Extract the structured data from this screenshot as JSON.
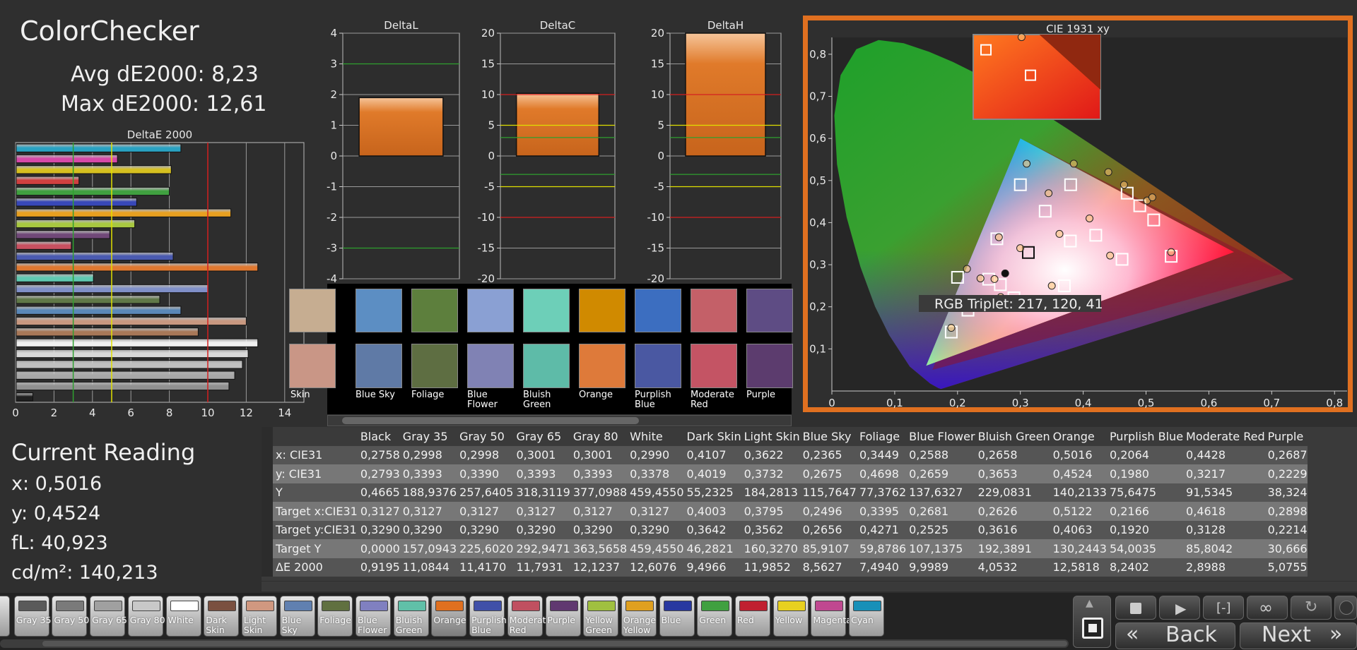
{
  "header": {
    "title": "ColorChecker",
    "avg_de": "Avg dE2000: 8,23",
    "max_de": "Max dE2000: 12,61"
  },
  "current_reading": {
    "title": "Current Reading",
    "x": "x: 0,5016",
    "y": "y: 0,4524",
    "fl": "fL: 40,923",
    "cd": "cd/m²: 140,213"
  },
  "chart_data": [
    {
      "type": "bar",
      "orientation": "horizontal",
      "title": "DeltaE 2000",
      "xlim": [
        0,
        15
      ],
      "xticks": [
        "0",
        "2",
        "4",
        "6",
        "8",
        "10",
        "12",
        "14"
      ],
      "reference_lines": [
        {
          "value": 3,
          "color": "#2fa02f"
        },
        {
          "value": 5,
          "color": "#e0e000"
        },
        {
          "value": 10,
          "color": "#d42020"
        }
      ],
      "bars": [
        {
          "value": 8.6,
          "color": "#2aa2c2"
        },
        {
          "value": 5.3,
          "color": "#d648a8"
        },
        {
          "value": 8.1,
          "color": "#d6c020"
        },
        {
          "value": 3.3,
          "color": "#d04040"
        },
        {
          "value": 8.0,
          "color": "#40a040"
        },
        {
          "value": 6.3,
          "color": "#3848b8"
        },
        {
          "value": 11.2,
          "color": "#e8a020"
        },
        {
          "value": 6.2,
          "color": "#a8c840"
        },
        {
          "value": 4.9,
          "color": "#704878"
        },
        {
          "value": 2.9,
          "color": "#c85060"
        },
        {
          "value": 8.2,
          "color": "#4a5ab0"
        },
        {
          "value": 12.6,
          "color": "#e07830"
        },
        {
          "value": 4.05,
          "color": "#60c8b0"
        },
        {
          "value": 10.0,
          "color": "#8090c8"
        },
        {
          "value": 7.5,
          "color": "#607848"
        },
        {
          "value": 8.6,
          "color": "#5a88b8"
        },
        {
          "value": 12.0,
          "color": "#c89880"
        },
        {
          "value": 9.5,
          "color": "#a87858"
        },
        {
          "value": 12.6,
          "color": "#f0f0f0"
        },
        {
          "value": 12.1,
          "color": "#d8d8d8"
        },
        {
          "value": 11.8,
          "color": "#c0c0c0"
        },
        {
          "value": 11.4,
          "color": "#a8a8a8"
        },
        {
          "value": 11.1,
          "color": "#909090"
        },
        {
          "value": 0.9,
          "color": "#202020"
        }
      ]
    },
    {
      "type": "bar",
      "title": "DeltaL",
      "ylim": [
        -4,
        4
      ],
      "yticks": [
        "4",
        "3",
        "2",
        "1",
        "0",
        "-1",
        "-2",
        "-3",
        "-4"
      ],
      "value": 1.9,
      "lines": [
        {
          "value": 3,
          "color": "#2fa02f"
        },
        {
          "value": -3,
          "color": "#2fa02f"
        }
      ]
    },
    {
      "type": "bar",
      "title": "DeltaC",
      "ylim": [
        -20,
        20
      ],
      "yticks": [
        "20",
        "15",
        "10",
        "5",
        "0",
        "-5",
        "-10",
        "-15",
        "-20"
      ],
      "value": 10.2,
      "lines": [
        {
          "value": 10,
          "color": "#d42020"
        },
        {
          "value": 5,
          "color": "#e0e000"
        },
        {
          "value": 3,
          "color": "#2fa02f"
        },
        {
          "value": -3,
          "color": "#2fa02f"
        },
        {
          "value": -5,
          "color": "#e0e000"
        },
        {
          "value": -10,
          "color": "#d42020"
        }
      ]
    },
    {
      "type": "bar",
      "title": "DeltaH",
      "ylim": [
        -20,
        20
      ],
      "yticks": [
        "20",
        "15",
        "10",
        "5",
        "0",
        "-5",
        "-10",
        "-15",
        "-20"
      ],
      "value": 20,
      "lines": [
        {
          "value": 10,
          "color": "#d42020"
        },
        {
          "value": 5,
          "color": "#e0e000"
        },
        {
          "value": 3,
          "color": "#2fa02f"
        },
        {
          "value": -3,
          "color": "#2fa02f"
        },
        {
          "value": -5,
          "color": "#e0e000"
        },
        {
          "value": -10,
          "color": "#d42020"
        }
      ]
    },
    {
      "type": "scatter",
      "title": "CIE 1931 xy",
      "xlim": [
        0,
        0.82
      ],
      "ylim": [
        0,
        0.84
      ],
      "xticks": [
        "0",
        "0,1",
        "0,2",
        "0,3",
        "0,4",
        "0,5",
        "0,6",
        "0,7",
        "0,8"
      ],
      "yticks": [
        "0,1",
        "0,2",
        "0,3",
        "0,4",
        "0,5",
        "0,6",
        "0,7",
        "0,8"
      ],
      "rgb_triplet": "RGB Triplet: 217, 120, 41",
      "targets": [
        [
          0.3127,
          0.329
        ],
        [
          0.3795,
          0.3562
        ],
        [
          0.2496,
          0.2656
        ],
        [
          0.3395,
          0.4271
        ],
        [
          0.2681,
          0.2525
        ],
        [
          0.2626,
          0.3616
        ],
        [
          0.5122,
          0.4063
        ],
        [
          0.2166,
          0.192
        ],
        [
          0.4618,
          0.3128
        ],
        [
          0.2898,
          0.2214
        ],
        [
          0.38,
          0.49
        ],
        [
          0.47,
          0.47
        ],
        [
          0.19,
          0.14
        ],
        [
          0.3,
          0.49
        ],
        [
          0.54,
          0.32
        ],
        [
          0.42,
          0.37
        ],
        [
          0.37,
          0.25
        ],
        [
          0.2,
          0.27
        ],
        [
          0.49,
          0.44
        ]
      ],
      "measured": [
        [
          0.2998,
          0.3393
        ],
        [
          0.3622,
          0.3732
        ],
        [
          0.2365,
          0.2675
        ],
        [
          0.3449,
          0.4698
        ],
        [
          0.2588,
          0.2659
        ],
        [
          0.2658,
          0.3653
        ],
        [
          0.5016,
          0.4524
        ],
        [
          0.2064,
          0.198
        ],
        [
          0.4428,
          0.3217
        ],
        [
          0.2687,
          0.2229
        ],
        [
          0.2758,
          0.2793
        ],
        [
          0.385,
          0.54
        ],
        [
          0.31,
          0.54
        ],
        [
          0.44,
          0.52
        ],
        [
          0.54,
          0.33
        ],
        [
          0.41,
          0.41
        ],
        [
          0.35,
          0.25
        ],
        [
          0.215,
          0.29
        ],
        [
          0.19,
          0.15
        ],
        [
          0.465,
          0.49
        ],
        [
          0.51,
          0.46
        ]
      ],
      "inset_targets": [
        [
          0.1,
          0.82
        ],
        [
          0.45,
          0.52
        ]
      ],
      "inset_measured": [
        [
          0.38,
          0.97
        ]
      ]
    }
  ],
  "swatches": {
    "top": [
      {
        "color": "#c6ad91"
      },
      {
        "color": "#5c8ec3"
      },
      {
        "color": "#5d7f3d"
      },
      {
        "color": "#8aa0d3"
      },
      {
        "color": "#6dcfb8"
      },
      {
        "color": "#d08a00"
      },
      {
        "color": "#3c6ec0"
      },
      {
        "color": "#c46068"
      },
      {
        "color": "#5e4c84"
      }
    ],
    "bottom": [
      {
        "color": "#c99686",
        "label": "Skin"
      },
      {
        "color": "#5f7aa6",
        "label": "Blue Sky"
      },
      {
        "color": "#5e6e42",
        "label": "Foliage"
      },
      {
        "color": "#8082b4",
        "label": "Blue Flower"
      },
      {
        "color": "#5ebba8",
        "label": "Bluish Green"
      },
      {
        "color": "#de7a3a",
        "label": "Orange"
      },
      {
        "color": "#4a58a2",
        "label": "Purplish Blue"
      },
      {
        "color": "#c45464",
        "label": "Moderate Red"
      },
      {
        "color": "#5c3c6e",
        "label": "Purple"
      }
    ]
  },
  "table": {
    "headers": [
      "Black",
      "Gray 35",
      "Gray 50",
      "Gray 65",
      "Gray 80",
      "White",
      "Dark Skin",
      "Light Skin",
      "Blue Sky",
      "Foliage",
      "Blue Flower",
      "Bluish Green",
      "Orange",
      "Purplish Blue",
      "Moderate Red",
      "Purple"
    ],
    "rows": [
      {
        "label": "x: CIE31",
        "values": [
          "0,2758",
          "0,2998",
          "0,2998",
          "0,3001",
          "0,3001",
          "0,2990",
          "0,4107",
          "0,3622",
          "0,2365",
          "0,3449",
          "0,2588",
          "0,2658",
          "0,5016",
          "0,2064",
          "0,4428",
          "0,2687"
        ]
      },
      {
        "label": "y: CIE31",
        "values": [
          "0,2793",
          "0,3393",
          "0,3390",
          "0,3393",
          "0,3393",
          "0,3378",
          "0,4019",
          "0,3732",
          "0,2675",
          "0,4698",
          "0,2659",
          "0,3653",
          "0,4524",
          "0,1980",
          "0,3217",
          "0,2229"
        ]
      },
      {
        "label": "Y",
        "values": [
          "0,4665",
          "188,9376",
          "257,6405",
          "318,3119",
          "377,0988",
          "459,4550",
          "55,2325",
          "184,2813",
          "115,7647",
          "77,3762",
          "137,6327",
          "229,0831",
          "140,2133",
          "75,6475",
          "91,5345",
          "38,324"
        ]
      },
      {
        "label": "Target x:CIE31",
        "values": [
          "0,3127",
          "0,3127",
          "0,3127",
          "0,3127",
          "0,3127",
          "0,3127",
          "0,4003",
          "0,3795",
          "0,2496",
          "0,3395",
          "0,2681",
          "0,2626",
          "0,5122",
          "0,2166",
          "0,4618",
          "0,2898"
        ]
      },
      {
        "label": "Target y:CIE31",
        "values": [
          "0,3290",
          "0,3290",
          "0,3290",
          "0,3290",
          "0,3290",
          "0,3290",
          "0,3642",
          "0,3562",
          "0,2656",
          "0,4271",
          "0,2525",
          "0,3616",
          "0,4063",
          "0,1920",
          "0,3128",
          "0,2214"
        ]
      },
      {
        "label": "Target Y",
        "values": [
          "0,0000",
          "157,0943",
          "225,6020",
          "292,9471",
          "363,5658",
          "459,4550",
          "46,2821",
          "160,3270",
          "85,9107",
          "59,8786",
          "107,1375",
          "192,3891",
          "130,2443",
          "54,0035",
          "85,8042",
          "30,666"
        ]
      },
      {
        "label": "ΔE 2000",
        "values": [
          "0,9195",
          "11,0844",
          "11,4170",
          "11,7931",
          "12,1237",
          "12,6076",
          "9,4966",
          "11,9852",
          "8,5627",
          "7,4940",
          "9,9989",
          "4,0532",
          "12,5818",
          "8,2402",
          "2,8988",
          "5,0755"
        ]
      }
    ]
  },
  "patch_buttons": [
    {
      "label": "Gray 35",
      "color": "#5a5a5a"
    },
    {
      "label": "Gray 50",
      "color": "#7a7a7a"
    },
    {
      "label": "Gray 65",
      "color": "#a0a0a0"
    },
    {
      "label": "Gray 80",
      "color": "#c8c8c8"
    },
    {
      "label": "White",
      "color": "#ffffff"
    },
    {
      "label": "Dark Skin",
      "color": "#7a5040"
    },
    {
      "label": "Light Skin",
      "color": "#d09880"
    },
    {
      "label": "Blue Sky",
      "color": "#6080b0"
    },
    {
      "label": "Foliage",
      "color": "#607040"
    },
    {
      "label": "Blue Flower",
      "color": "#8080c0"
    },
    {
      "label": "Bluish Green",
      "color": "#60c0a8"
    },
    {
      "label": "Orange",
      "color": "#e07020"
    },
    {
      "label": "Purplish Blue",
      "color": "#4050a8"
    },
    {
      "label": "Moderate Red",
      "color": "#c05060"
    },
    {
      "label": "Purple",
      "color": "#603870"
    },
    {
      "label": "Yellow Green",
      "color": "#a0c040"
    },
    {
      "label": "Orange Yellow",
      "color": "#e0a020"
    },
    {
      "label": "Blue",
      "color": "#2838a0"
    },
    {
      "label": "Green",
      "color": "#40a040"
    },
    {
      "label": "Red",
      "color": "#c02030"
    },
    {
      "label": "Yellow",
      "color": "#e8d020"
    },
    {
      "label": "Magenta",
      "color": "#c04890"
    },
    {
      "label": "Cyan",
      "color": "#1890b8"
    }
  ],
  "controls": {
    "back": "Back",
    "next": "Next",
    "back_glyph": "«",
    "next_glyph": "»"
  }
}
